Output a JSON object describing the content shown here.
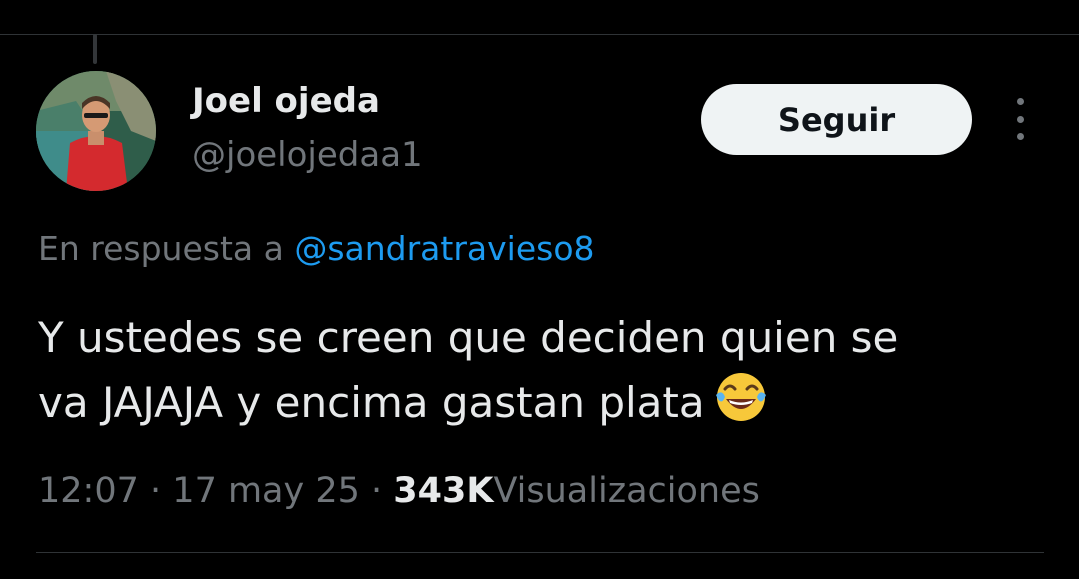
{
  "tweet": {
    "author": {
      "display_name": "Joel ojeda",
      "handle": "@joelojedaa1"
    },
    "follow_label": "Seguir",
    "reply_prefix": "En respuesta a",
    "reply_to": "@sandratravieso8",
    "text_line1": "Y ustedes se creen que deciden quien se",
    "text_line2": "va JAJAJA y encima gastan plata",
    "emoji": "tears-of-joy-emoji",
    "time": "12:07",
    "date": "17 may 25",
    "separator": "·",
    "views_count": "343K",
    "views_label": "Visualizaciones"
  },
  "colors": {
    "background": "#000000",
    "primary_text": "#e7e9ea",
    "secondary_text": "#71767b",
    "link": "#1d9bf0",
    "follow_button_bg": "#eff3f4",
    "divider": "#2f3336"
  }
}
